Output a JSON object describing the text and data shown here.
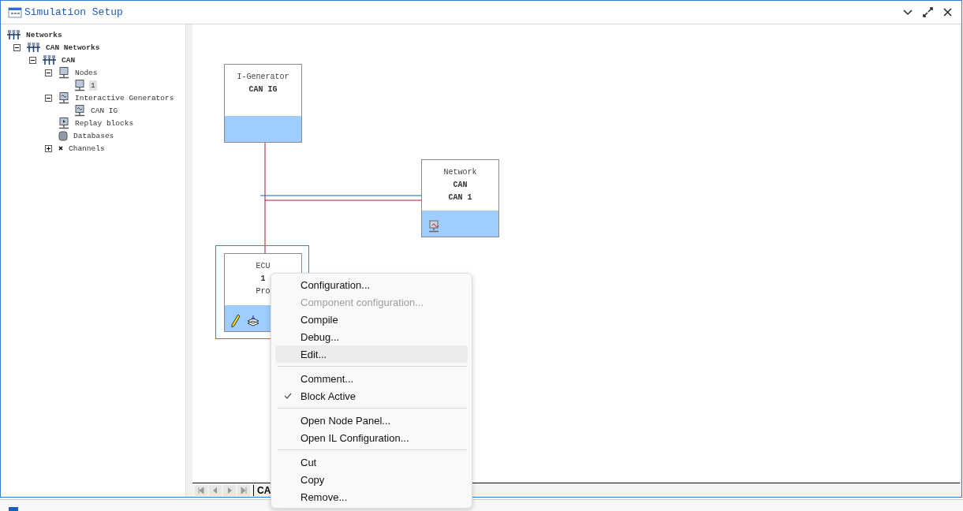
{
  "window": {
    "title": "Simulation Setup"
  },
  "tree": [
    {
      "label": "Networks",
      "kind": "network",
      "bold": true,
      "selected": false,
      "children": [
        {
          "label": "CAN Networks",
          "kind": "network",
          "bold": true,
          "expanded": true,
          "selected": false,
          "children": [
            {
              "label": "CAN",
              "kind": "network",
              "bold": true,
              "expanded": true,
              "selected": false,
              "children": [
                {
                  "label": "Nodes",
                  "kind": "node",
                  "bold": false,
                  "expanded": true,
                  "selected": false,
                  "children": [
                    {
                      "label": "1",
                      "kind": "node",
                      "bold": false,
                      "selected": true
                    }
                  ]
                },
                {
                  "label": "Interactive Generators",
                  "kind": "generator",
                  "bold": false,
                  "expanded": true,
                  "selected": false,
                  "children": [
                    {
                      "label": "CAN IG",
                      "kind": "generator",
                      "bold": false,
                      "selected": false
                    }
                  ]
                },
                {
                  "label": "Replay blocks",
                  "kind": "replay",
                  "bold": false,
                  "selected": false
                },
                {
                  "label": "Databases",
                  "kind": "database",
                  "bold": false,
                  "selected": false
                },
                {
                  "label": "Channels",
                  "kind": "channel",
                  "bold": false,
                  "expanded": false,
                  "selected": false
                }
              ]
            }
          ]
        }
      ]
    }
  ],
  "blocks": [
    {
      "kind": "generator",
      "type": "I-Generator",
      "name": "CAN IG",
      "selected": false
    },
    {
      "kind": "network",
      "type": "Network",
      "name": "CAN",
      "subname": "CAN 1",
      "selected": false
    },
    {
      "kind": "ecu",
      "type": "ECU",
      "name": "1",
      "subname": "Pro",
      "selected": true
    }
  ],
  "sheet_tab": "CA",
  "context_menu": [
    [
      {
        "label": "Configuration...",
        "disabled": false,
        "highlighted": false,
        "checked": false
      },
      {
        "label": "Component configuration...",
        "disabled": true,
        "highlighted": false,
        "checked": false
      },
      {
        "label": "Compile",
        "disabled": false,
        "highlighted": false,
        "checked": false
      },
      {
        "label": "Debug...",
        "disabled": false,
        "highlighted": false,
        "checked": false
      },
      {
        "label": "Edit...",
        "disabled": false,
        "highlighted": true,
        "checked": false
      }
    ],
    [
      {
        "label": "Comment...",
        "disabled": false,
        "highlighted": false,
        "checked": false
      },
      {
        "label": "Block Active",
        "disabled": false,
        "highlighted": false,
        "checked": true
      }
    ],
    [
      {
        "label": "Open Node Panel...",
        "disabled": false,
        "highlighted": false,
        "checked": false
      },
      {
        "label": "Open IL Configuration...",
        "disabled": false,
        "highlighted": false,
        "checked": false
      }
    ],
    [
      {
        "label": "Cut",
        "disabled": false,
        "highlighted": false,
        "checked": false
      },
      {
        "label": "Copy",
        "disabled": false,
        "highlighted": false,
        "checked": false
      },
      {
        "label": "Remove...",
        "disabled": false,
        "highlighted": false,
        "checked": false
      }
    ]
  ]
}
